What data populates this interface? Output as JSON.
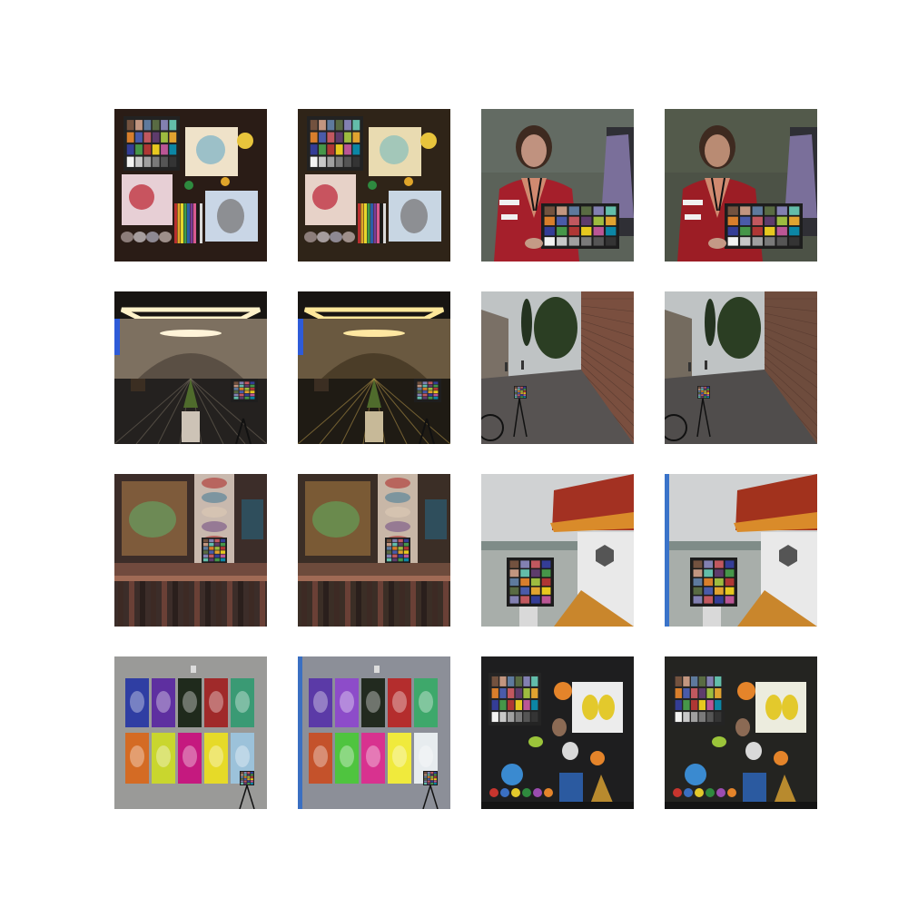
{
  "grid": {
    "rows": 4,
    "cols": 4,
    "pairs": [
      {
        "row": 0,
        "left": "art-table",
        "right": "woman-checker"
      },
      {
        "row": 1,
        "left": "mall-corridor",
        "right": "street-wall"
      },
      {
        "row": 2,
        "left": "temple-facade",
        "right": "pagoda-lake"
      },
      {
        "row": 3,
        "left": "poster-wall",
        "right": "toy-shelf"
      }
    ]
  },
  "palette": {
    "checker": [
      "#73523f",
      "#c29680",
      "#5e7a9d",
      "#596b43",
      "#8280b1",
      "#63bdaa",
      "#d87e2c",
      "#4a5ba9",
      "#c1585f",
      "#5e3c6c",
      "#9dbb40",
      "#e0a330",
      "#343d96",
      "#469649",
      "#af3734",
      "#e7c81f",
      "#bb5695",
      "#0c86a5",
      "#f3f3f2",
      "#c8c8c8",
      "#a0a0a0",
      "#7a7a7a",
      "#555555",
      "#343434"
    ]
  }
}
